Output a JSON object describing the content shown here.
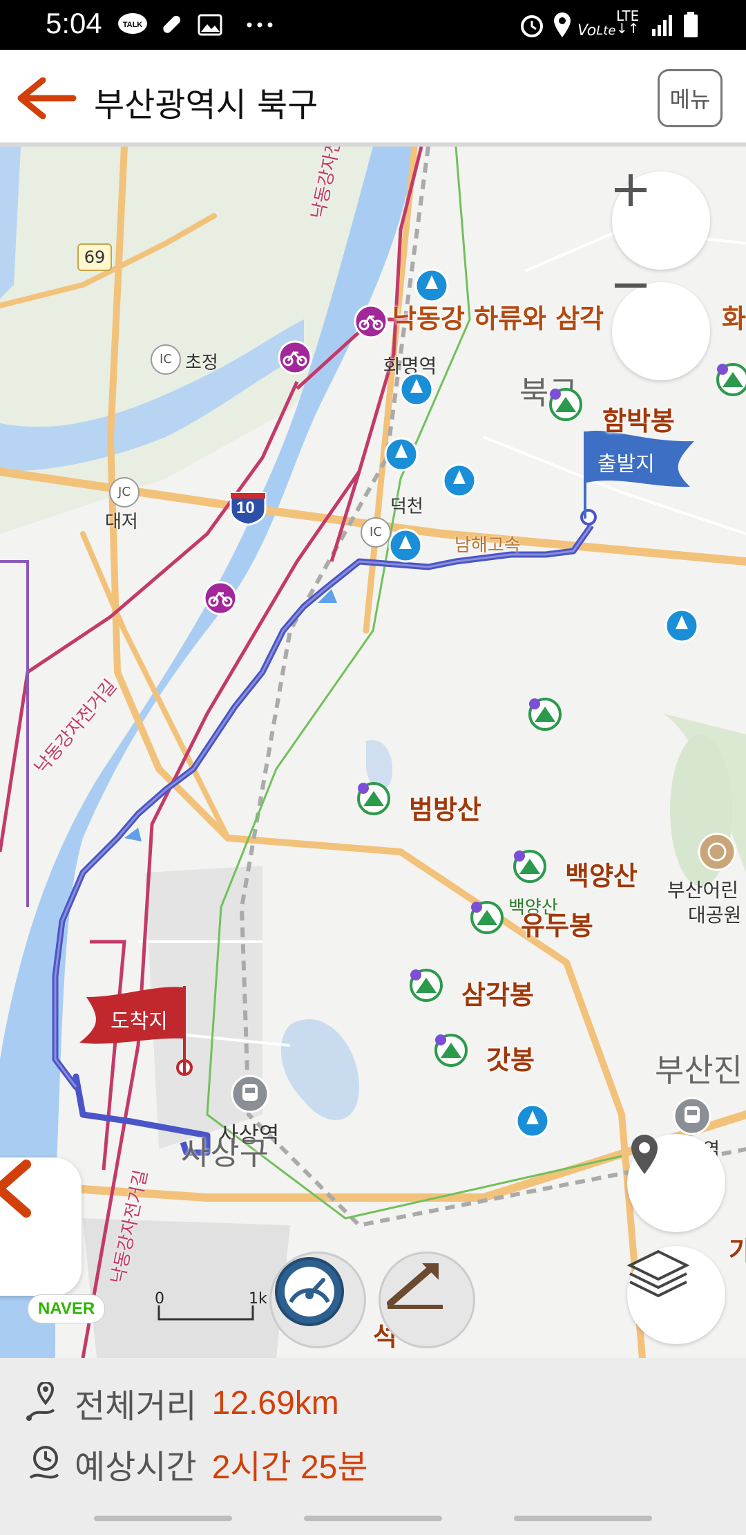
{
  "status_bar": {
    "time": "5:04",
    "icons": [
      "talk-icon",
      "pill-icon",
      "image-icon",
      "more-icon",
      "alarm-icon",
      "location-icon",
      "volte-icon",
      "lte-icon",
      "signal-icon",
      "battery-icon"
    ],
    "network": "VoLTE LTE"
  },
  "header": {
    "title": "부산광역시 북구",
    "menu_label": "메뉴",
    "accent": "#d2400a"
  },
  "map": {
    "route_color": "#4a55c8",
    "start_flag": "출발지",
    "end_flag": "도착지",
    "labels": {
      "nakdong_trail": "낙동강 하류와 삼각",
      "nakdong_trail_tail": "화",
      "hwamyeong_station": "화명역",
      "bukgu": "북구",
      "hambakbong": "함박봉",
      "chojeong": "초정",
      "daejeo": "대저",
      "route69": "69",
      "route10": "10",
      "ic_gupo": "덕천",
      "namhae_expressway": "남해고속",
      "beombangsan": "범방산",
      "baekyangsan": "백양산",
      "baekyangsan_small": "백양산",
      "yudubong": "유두봉",
      "samgakbong": "삼각봉",
      "gatbong": "갓봉",
      "busan_park_1": "부산어린",
      "busan_park_2": "대공원",
      "busanjin": "부산진",
      "sasang_station": "사상역",
      "sasang_gu": "사상구",
      "bike_trail_top": "낙동강자전거",
      "bike_trail_left": "낙동강자전거길",
      "bike_trail_bottom": "낙동강자전거길",
      "scale_zero": "0",
      "scale_one": "1k",
      "bottom_cut": "석",
      "right_cut": "가",
      "right_station_cut": "역"
    },
    "naver_logo": "NAVER"
  },
  "info": {
    "distance_label": "전체거리",
    "distance_value": "12.69km",
    "time_label": "예상시간",
    "time_value": "2시간 25분"
  }
}
